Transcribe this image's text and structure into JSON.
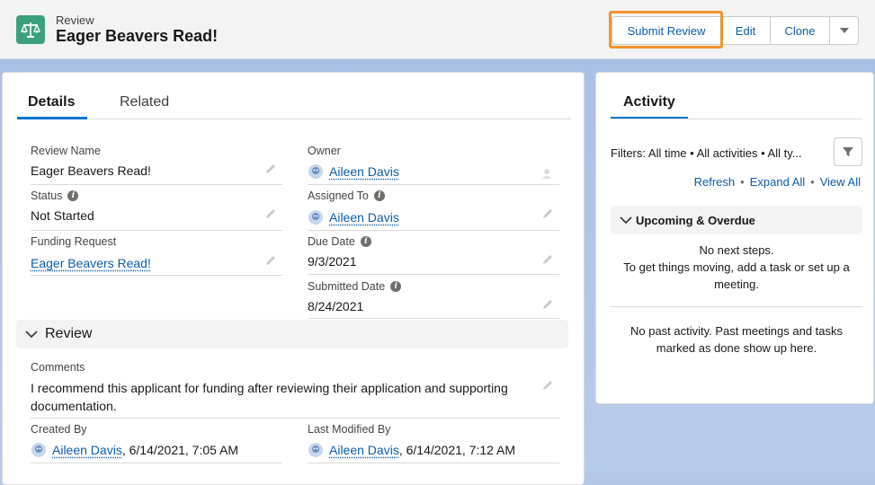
{
  "header": {
    "object_type": "Review",
    "record_title": "Eager Beavers Read!",
    "object_icon": "scales-icon",
    "buttons": {
      "submit_review": "Submit Review",
      "edit": "Edit",
      "clone": "Clone"
    }
  },
  "details": {
    "tabs": [
      "Details",
      "Related"
    ],
    "fields": {
      "review_name": {
        "label": "Review Name",
        "value": "Eager Beavers Read!"
      },
      "owner": {
        "label": "Owner",
        "value": "Aileen Davis"
      },
      "status": {
        "label": "Status",
        "value": "Not Started"
      },
      "assigned_to": {
        "label": "Assigned To",
        "value": "Aileen Davis"
      },
      "funding_request": {
        "label": "Funding Request",
        "value": "Eager Beavers Read!"
      },
      "due_date": {
        "label": "Due Date",
        "value": "9/3/2021"
      },
      "submitted_date": {
        "label": "Submitted Date",
        "value": "8/24/2021"
      }
    },
    "review_section": {
      "title": "Review",
      "comments_label": "Comments",
      "comments_line1": "I recommend this applicant for funding after reviewing their application and supporting",
      "comments_line2": "documentation."
    },
    "audit": {
      "created_by_label": "Created By",
      "created_by_name": "Aileen Davis",
      "created_by_date": ", 6/14/2021, 7:05 AM",
      "modified_by_label": "Last Modified By",
      "modified_by_name": "Aileen Davis",
      "modified_by_date": ", 6/14/2021, 7:12 AM"
    }
  },
  "activity": {
    "tab": "Activity",
    "filters": "Filters: All time • All activities • All ty...",
    "links": {
      "refresh": "Refresh",
      "expand_all": "Expand All",
      "view_all": "View All",
      "separator": "•"
    },
    "upcoming_title": "Upcoming & Overdue",
    "no_next_line1": "No next steps.",
    "no_next_line2": "To get things moving, add a task or set up a",
    "no_next_line3": "meeting.",
    "no_past_line1": "No past activity. Past meetings and tasks",
    "no_past_line2": "marked as done show up here."
  },
  "colors": {
    "brand": "#0176d3",
    "link": "#0b5cab",
    "icon_bg": "#3ba17c",
    "highlight": "#f0932b"
  }
}
